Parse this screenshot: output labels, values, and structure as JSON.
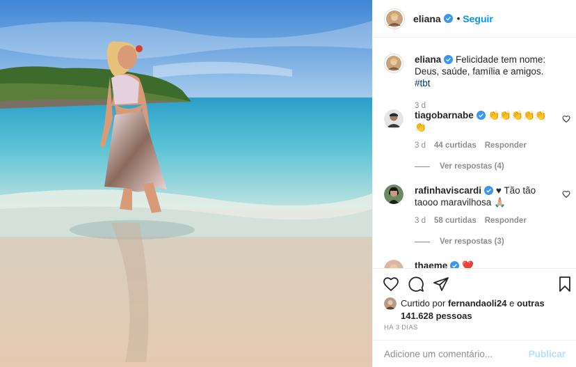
{
  "header": {
    "username": "eliana",
    "separator": "•",
    "follow_label": "Seguir"
  },
  "caption": {
    "username": "eliana",
    "text": "Felicidade tem nome: Deus, saúde, família e amigos.",
    "hashtag": "#tbt",
    "time": "3 d"
  },
  "comments": [
    {
      "username": "tiagobarnabe",
      "text": "👏👏👏👏👏👏",
      "time": "3 d",
      "likes": "44 curtidas",
      "reply_label": "Responder",
      "view_replies": "Ver respostas (4)"
    },
    {
      "username": "rafinhaviscardi",
      "text": "♥ Tão tão taooo maravilhosa 🙏🏼",
      "time": "3 d",
      "likes": "58 curtidas",
      "reply_label": "Responder",
      "view_replies": "Ver respostas (3)"
    },
    {
      "username": "thaeme",
      "text": "❤️"
    }
  ],
  "likes": {
    "prefix": "Curtido por",
    "user": "fernandaoli24",
    "connector": "e",
    "others": "outras 141.628 pessoas"
  },
  "timestamp": "HÁ 3 DIAS",
  "add_comment": {
    "placeholder": "Adicione um comentário...",
    "publish_label": "Publicar"
  },
  "colors": {
    "accent": "#0095f6",
    "verified": "#3897f0",
    "publish_disabled": "#b2dffc"
  },
  "icons": {
    "like": "heart-icon",
    "comment": "comment-icon",
    "share": "share-icon",
    "save": "bookmark-icon"
  }
}
